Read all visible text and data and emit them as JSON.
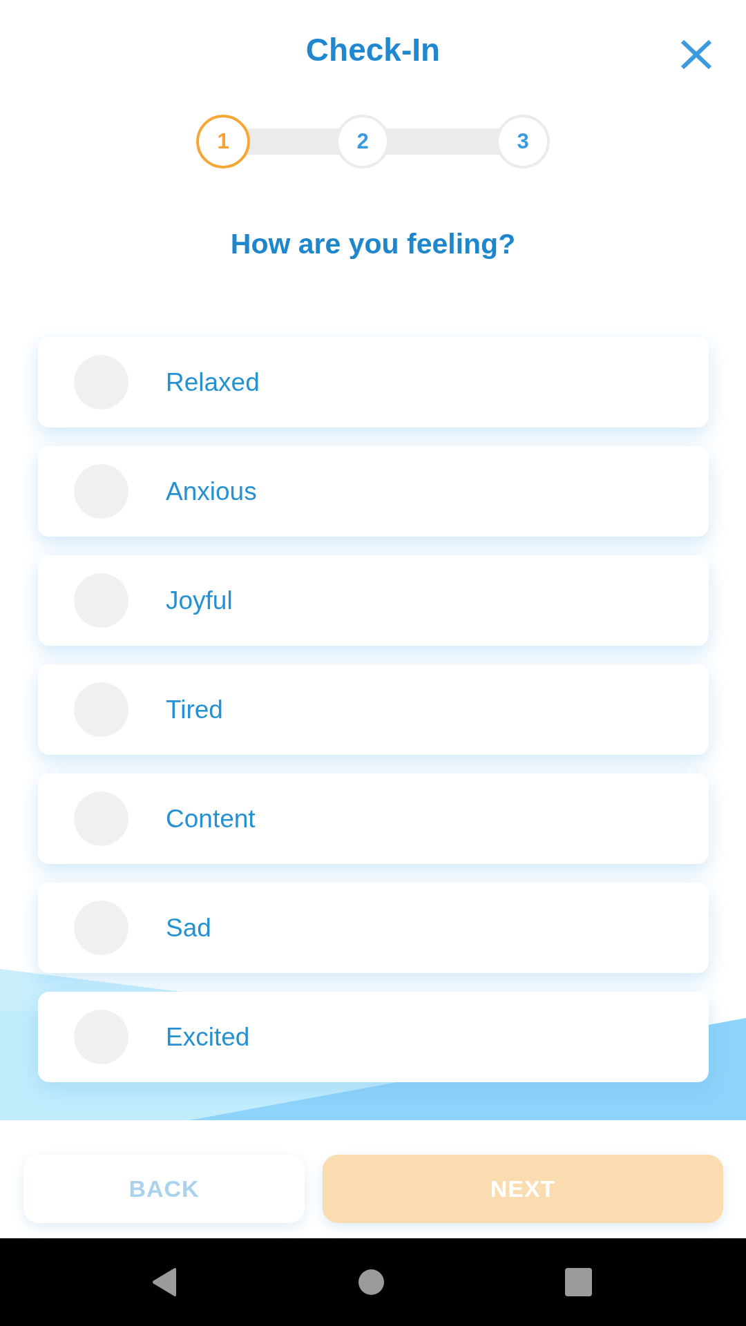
{
  "header": {
    "title": "Check-In"
  },
  "steps": [
    {
      "label": "1",
      "current": true
    },
    {
      "label": "2",
      "current": false
    },
    {
      "label": "3",
      "current": false
    }
  ],
  "question": "How are you feeling?",
  "options": [
    {
      "label": "Relaxed",
      "selected": false
    },
    {
      "label": "Anxious",
      "selected": false
    },
    {
      "label": "Joyful",
      "selected": false
    },
    {
      "label": "Tired",
      "selected": false
    },
    {
      "label": "Content",
      "selected": false
    },
    {
      "label": "Sad",
      "selected": false
    },
    {
      "label": "Excited",
      "selected": false
    }
  ],
  "buttons": [
    {
      "kind": "secondary",
      "label": "BACK",
      "disabled": true
    },
    {
      "kind": "primary",
      "label": "NEXT",
      "disabled": true
    }
  ]
}
